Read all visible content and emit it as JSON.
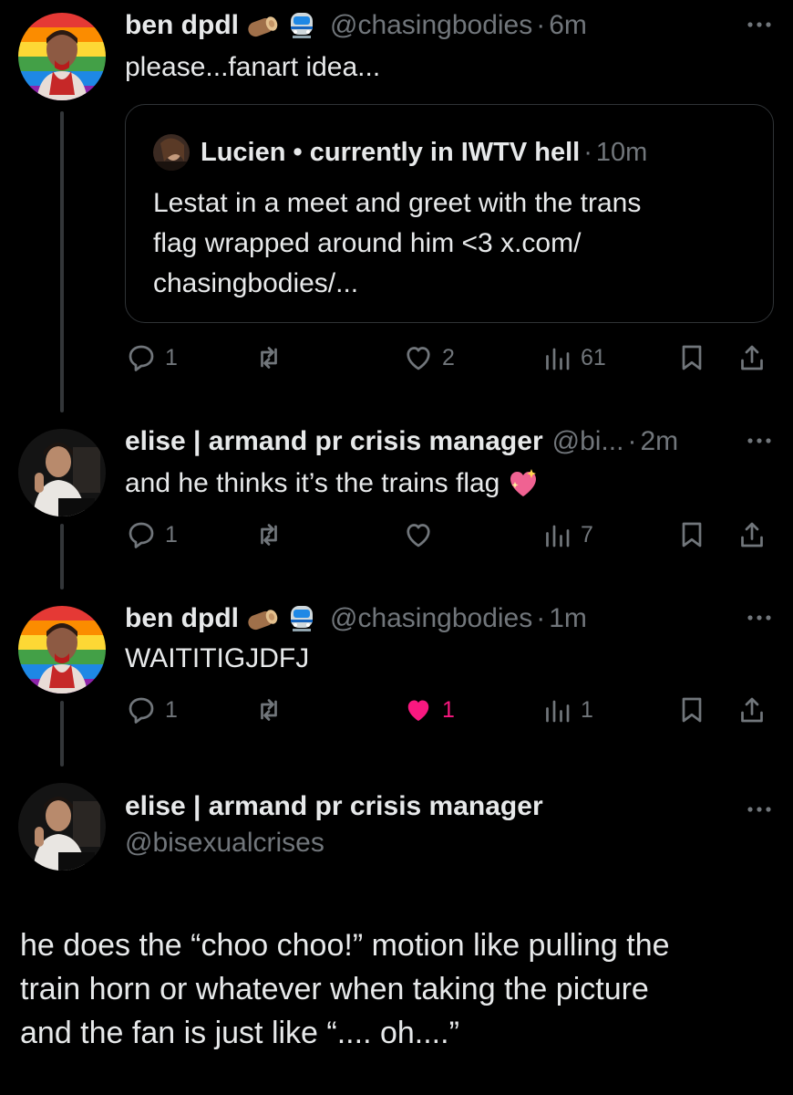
{
  "posts": [
    {
      "name": "ben dpdl",
      "emojis": [
        "wood-log-icon",
        "train-icon"
      ],
      "handle": "@chasingbodies",
      "sep": "·",
      "time": "6m",
      "text": "please...fanart idea...",
      "quote": {
        "name": "Lucien • currently in IWTV hell",
        "sep": "·",
        "time": "10m",
        "lines": [
          "Lestat in a meet and greet with the trans",
          "flag wrapped around him <3 x.com/",
          "chasingbodies/..."
        ]
      },
      "replies": "1",
      "reposts": "",
      "likes": "2",
      "views": "61",
      "liked": false
    },
    {
      "name": "elise | armand pr crisis manager",
      "handle": "@bi...",
      "sep": "·",
      "time": "2m",
      "text": "and he thinks it’s the trains flag",
      "text_emoji": "sparkling-heart-icon",
      "replies": "1",
      "reposts": "",
      "likes": "",
      "views": "7",
      "liked": false
    },
    {
      "name": "ben dpdl",
      "emojis": [
        "wood-log-icon",
        "train-icon"
      ],
      "handle": "@chasingbodies",
      "sep": "·",
      "time": "1m",
      "text": "WAITITIGJDFJ",
      "replies": "1",
      "reposts": "",
      "likes": "1",
      "views": "1",
      "liked": true
    }
  ],
  "main_post": {
    "name": "elise | armand pr crisis manager",
    "handle": "@bisexualcrises",
    "lines": [
      "he does the “choo choo!” motion like pulling the",
      "train horn or whatever when taking the picture",
      "and the fan is just like “.... oh....”"
    ]
  },
  "colors": {
    "background": "#000000",
    "text": "#e7e9ea",
    "muted": "#71767b",
    "like": "#f91880",
    "border": "#2f3336"
  }
}
